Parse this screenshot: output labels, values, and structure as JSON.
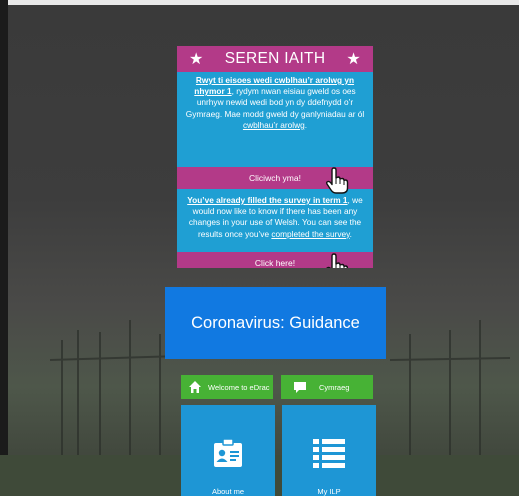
{
  "banner": {
    "title": "SEREN IAITH",
    "welsh": {
      "link1": "Rwyt ti eisoes wedi cwblhau’r arolwg yn nhymor 1",
      "text": ", rydym nwan eisiau gweld os oes unrhyw newid wedi bod yn dy ddefnydd o’r Gymraeg. Mae modd gweld dy ganlyniadau ar ól ",
      "link2": "cwblhau’r arolwg",
      "end": ".",
      "button": "Cliciwch yma!"
    },
    "english": {
      "link1": "You’ve already filled the survey in term 1",
      "text": ", we would now like to know if there has been any changes in your use of Welsh. You can see the results once you’ve ",
      "link2": "completed the survey",
      "end": ".",
      "button": "Click here!"
    },
    "colors": {
      "pink": "#b33a88",
      "blue": "#1f9fd3"
    }
  },
  "guidance": {
    "label": "Coronavirus: Guidance",
    "color": "#1179e1"
  },
  "quick_links": [
    {
      "label": "Welcome to eDrac",
      "icon": "home-icon"
    },
    {
      "label": "Cymraeg",
      "icon": "speech-bubble-icon"
    }
  ],
  "tiles": [
    {
      "label": "About me",
      "icon": "id-badge-icon"
    },
    {
      "label": "My ILP",
      "icon": "list-icon"
    }
  ]
}
